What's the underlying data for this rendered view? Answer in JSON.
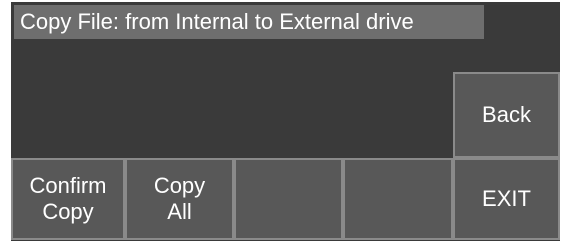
{
  "title": "Copy File: from Internal to External drive",
  "buttons": {
    "back": "Back",
    "confirm_copy": [
      "Confirm",
      "Copy"
    ],
    "copy_all": [
      "Copy",
      "All"
    ],
    "blank_3": "",
    "blank_4": "",
    "exit": "EXIT"
  },
  "colors": {
    "screen_background": "#3a3a3a",
    "title_bar": "#6e6e6e",
    "button_face": "#585858",
    "button_border": "#8a8a8a",
    "text": "#ffffff"
  }
}
